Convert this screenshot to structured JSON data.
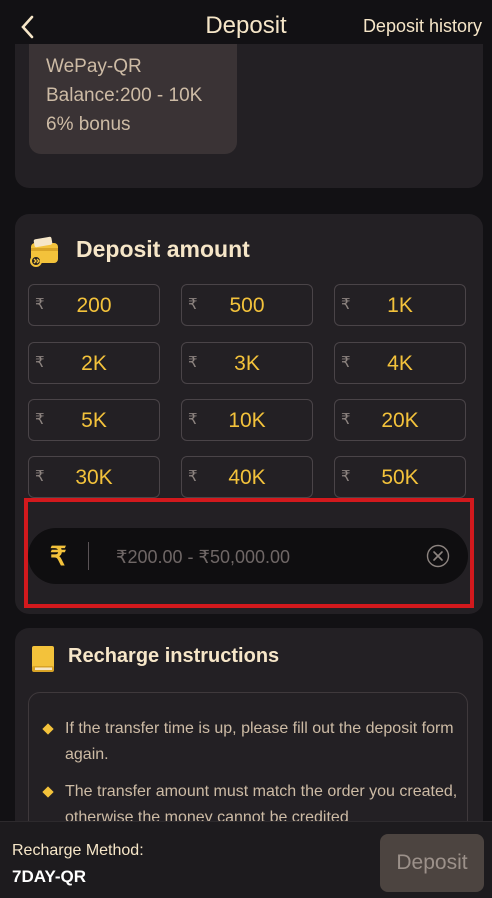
{
  "header": {
    "title": "Deposit",
    "history_label": "Deposit history"
  },
  "method": {
    "name": "WePay-QR",
    "balance": "Balance:200 - 10K",
    "bonus": "6% bonus"
  },
  "deposit_amount": {
    "title": "Deposit amount",
    "currency_symbol": "₹",
    "amounts": [
      "200",
      "500",
      "1K",
      "2K",
      "3K",
      "4K",
      "5K",
      "10K",
      "20K",
      "30K",
      "40K",
      "50K"
    ],
    "input_placeholder": "₹200.00 - ₹50,000.00",
    "input_value": ""
  },
  "instructions": {
    "title": "Recharge instructions",
    "items": [
      "If the transfer time is up, please fill out the deposit form again.",
      "The transfer amount must match the order you created, otherwise the money cannot be credited"
    ]
  },
  "footer": {
    "method_label": "Recharge Method:",
    "method_value": "7DAY-QR",
    "deposit_button": "Deposit"
  },
  "colors": {
    "accent": "#f3c23b",
    "background": "#121114",
    "card": "#232024",
    "highlight": "#d2191d"
  }
}
